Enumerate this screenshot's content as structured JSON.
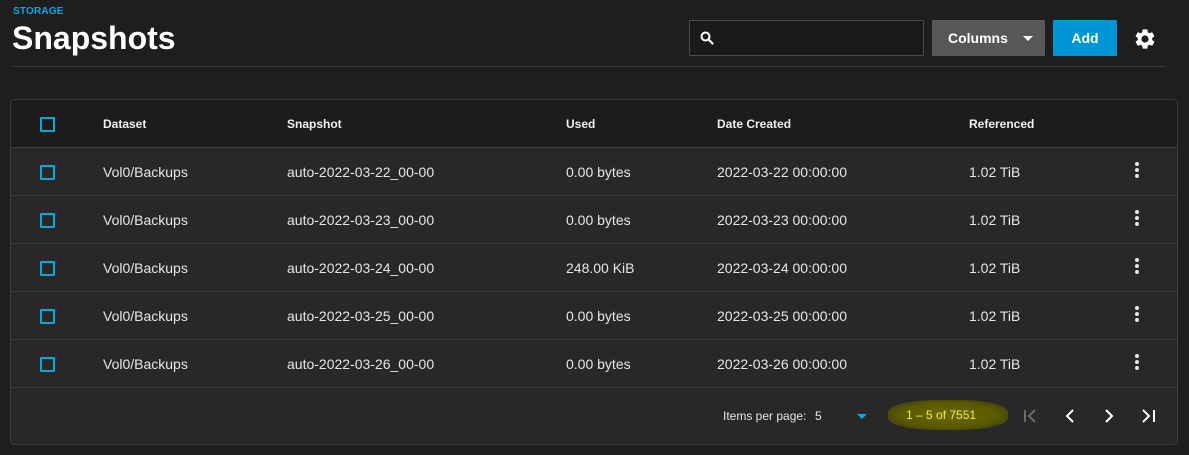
{
  "header": {
    "breadcrumb": "STORAGE",
    "title": "Snapshots",
    "search_placeholder": "",
    "columns_label": "Columns",
    "add_label": "Add"
  },
  "table": {
    "headers": {
      "dataset": "Dataset",
      "snapshot": "Snapshot",
      "used": "Used",
      "date_created": "Date Created",
      "referenced": "Referenced"
    },
    "rows": [
      {
        "dataset": "Vol0/Backups",
        "snapshot": "auto-2022-03-22_00-00",
        "used": "0.00 bytes",
        "date_created": "2022-03-22 00:00:00",
        "referenced": "1.02 TiB"
      },
      {
        "dataset": "Vol0/Backups",
        "snapshot": "auto-2022-03-23_00-00",
        "used": "0.00 bytes",
        "date_created": "2022-03-23 00:00:00",
        "referenced": "1.02 TiB"
      },
      {
        "dataset": "Vol0/Backups",
        "snapshot": "auto-2022-03-24_00-00",
        "used": "248.00 KiB",
        "date_created": "2022-03-24 00:00:00",
        "referenced": "1.02 TiB"
      },
      {
        "dataset": "Vol0/Backups",
        "snapshot": "auto-2022-03-25_00-00",
        "used": "0.00 bytes",
        "date_created": "2022-03-25 00:00:00",
        "referenced": "1.02 TiB"
      },
      {
        "dataset": "Vol0/Backups",
        "snapshot": "auto-2022-03-26_00-00",
        "used": "0.00 bytes",
        "date_created": "2022-03-26 00:00:00",
        "referenced": "1.02 TiB"
      }
    ]
  },
  "paginator": {
    "items_per_page_label": "Items per page:",
    "items_per_page_value": "5",
    "range_label": "1 – 5 of 7551"
  },
  "icons": {
    "search": "search-icon",
    "settings": "gear-icon",
    "row_menu": "more-vert-icon",
    "first_page": "first-page-icon",
    "prev_page": "chevron-left-icon",
    "next_page": "chevron-right-icon",
    "last_page": "last-page-icon"
  },
  "colors": {
    "accent": "#0ea6e0",
    "add_button": "#0095d5",
    "columns_button": "#585858",
    "background": "#1e1e1e",
    "card": "#282828",
    "highlight": "#f4ec3a"
  }
}
